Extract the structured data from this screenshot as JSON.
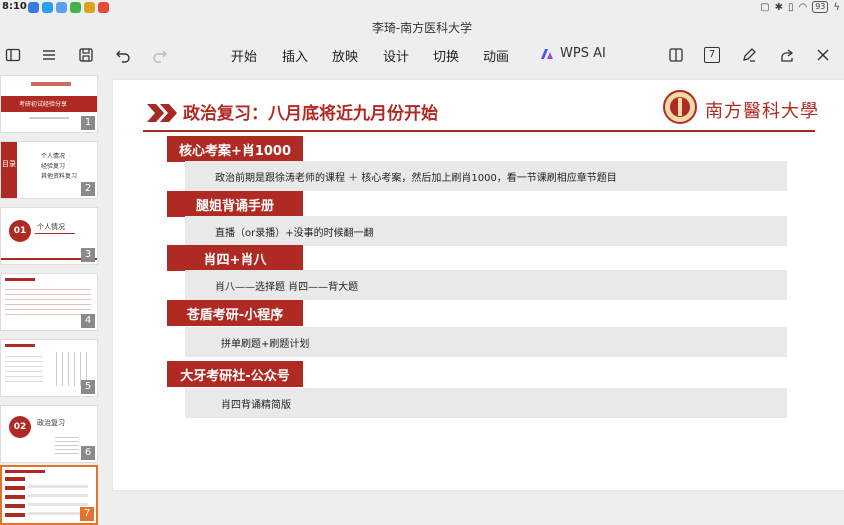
{
  "status": {
    "time": "8:10",
    "battery": "93"
  },
  "window": {
    "title": "李琦-南方医科大学"
  },
  "toolbar": {
    "menus": [
      "开始",
      "插入",
      "放映",
      "设计",
      "切换",
      "动画"
    ],
    "wps_ai": "WPS AI",
    "page_box": "7"
  },
  "thumbnails": {
    "numbers": [
      "1",
      "2",
      "3",
      "4",
      "5",
      "6",
      "7"
    ],
    "t1_title": "考研初试经验分享",
    "t2_title": "目录",
    "t2_items": [
      "个人情况",
      "经验复习",
      "其他资料复习"
    ],
    "t3_num": "01",
    "t3_title": "个人情况",
    "t6_num": "02",
    "t6_title": "政治复习"
  },
  "slide": {
    "title": "政治复习：八月底将近九月份开始",
    "university": "南方醫科大學",
    "sections": [
      {
        "heading": "核心考案+肖1000",
        "body": "政治前期是跟徐涛老师的课程 ＋ 核心考案，然后加上刷肖1000，看一节课刷相应章节题目"
      },
      {
        "heading": "腿姐背诵手册",
        "body": "直播（or录播）+没事的时候翻一翻"
      },
      {
        "heading": "肖四+肖八",
        "body": "肖八——选择题  肖四——背大题"
      },
      {
        "heading": "苍盾考研-小程序",
        "body": "拼单刷题+刷题计划"
      },
      {
        "heading": "大牙考研社-公众号",
        "body": "肖四背诵精简版"
      }
    ]
  },
  "colors": {
    "accent": "#b02a24",
    "active_thumb": "#e0752a",
    "body_bg": "#e9e9e9"
  }
}
